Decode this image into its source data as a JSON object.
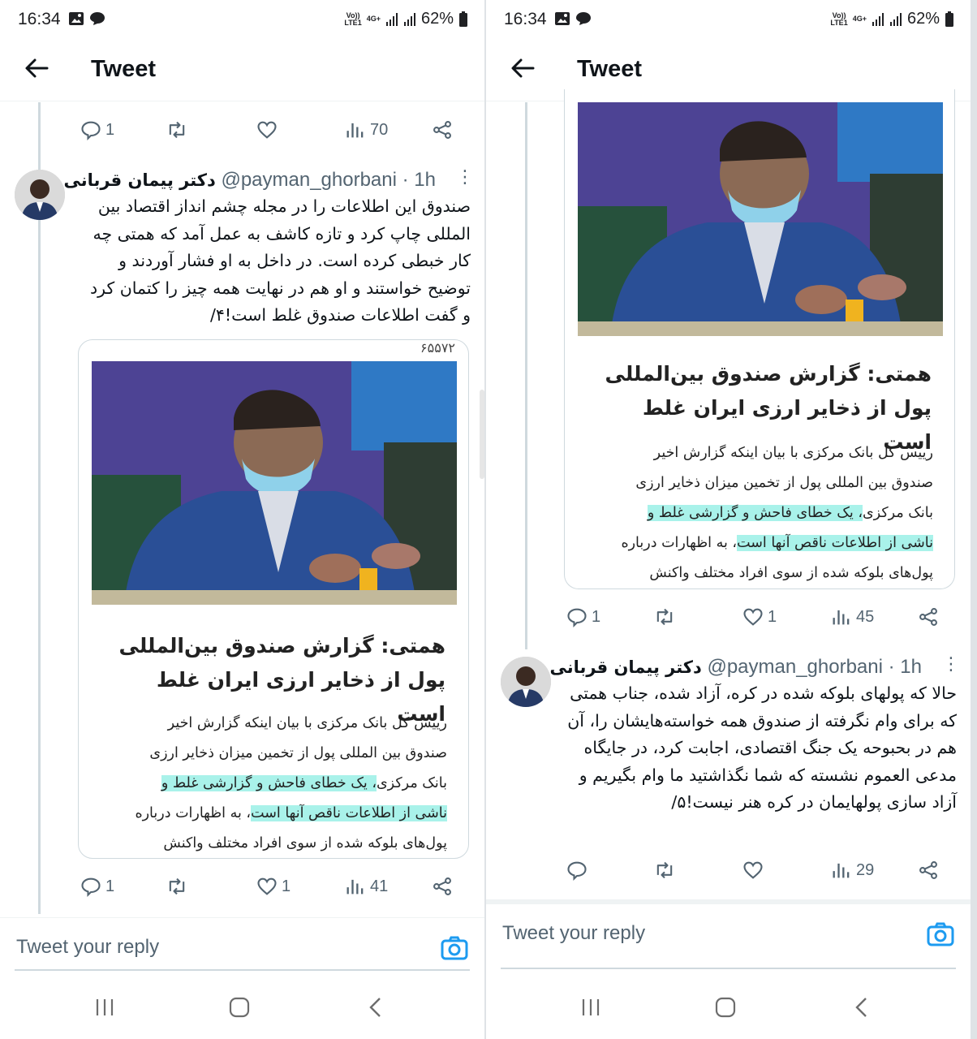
{
  "status": {
    "time": "16:34",
    "network_top": "Vo))",
    "network_bottom": "LTE1",
    "network_type": "4G+",
    "battery": "62%"
  },
  "header": {
    "title": "Tweet"
  },
  "left": {
    "top_actions": {
      "replies": "1",
      "views": "70"
    },
    "tweet": {
      "name": "دکتر پیمان قربانی",
      "handle": "@payman_ghorbani",
      "time": "· 1h",
      "text": "صندوق این اطلاعات را در مجله چشم انداز اقتصاد بین المللی چاپ کرد و تازه کاشف به عمل آمد که همتی چه کار خبطی کرده است. در داخل به او فشار آوردند و توضیح خواستند و او هم در نهایت همه چیز را کتمان کرد و گفت اطلاعات صندوق غلط است!۴/"
    },
    "card": {
      "counter": "۶۵۵۷۲",
      "headline": "همتی: گزارش صندوق بین‌المللی پول از ذخایر ارزی ایران غلط است",
      "lines": [
        "رییس کل بانک مرکزی با بیان اینکه گزارش اخیر",
        "صندوق بین المللی پول از تخمین میزان ذخایر ارزی",
        "بانک مرکزی، یک خطای فاحش و گزارشی غلط و",
        "ناشی از اطلاعات ناقص آنها است",
        "، به اظهارات درباره",
        "پول‌های بلوکه شده از سوی افراد مختلف واکنش"
      ],
      "line3_plain": "بانک مرکزی",
      "line3_hl": "، یک خطای فاحش و گزارشی غلط و"
    },
    "bottom_actions": {
      "replies": "1",
      "likes": "1",
      "views": "41"
    }
  },
  "right": {
    "card_actions": {
      "replies": "1",
      "likes": "1",
      "views": "45"
    },
    "tweet": {
      "name": "دکتر پیمان قربانی",
      "handle": "@payman_ghorbani",
      "time": "· 1h",
      "text": "حالا که پولهای بلوکه شده در کره، آزاد شده، جناب همتی که برای وام نگرفته از صندوق همه خواسته‌هایشان را، آن هم در بحبوحه یک جنگ اقتصادی، اجابت کرد، در جایگاه مدعی العموم نشسته که شما نگذاشتید ما وام بگیریم و آزاد سازی پولهایمان در کره هنر نیست!۵/"
    },
    "bottom_actions": {
      "views": "29"
    }
  },
  "reply": {
    "placeholder": "Tweet your reply"
  },
  "icons": [
    "back-arrow-icon",
    "reply-icon",
    "retweet-icon",
    "like-icon",
    "views-icon",
    "share-icon",
    "more-icon",
    "camera-icon",
    "gallery-icon",
    "chat-icon",
    "signal-icon",
    "battery-icon",
    "recents-icon",
    "home-icon",
    "back-icon"
  ],
  "colors": {
    "accent": "#1d9bf0",
    "muted": "#536471",
    "highlight": "#a9f2ea",
    "divider": "#cfd9de"
  }
}
